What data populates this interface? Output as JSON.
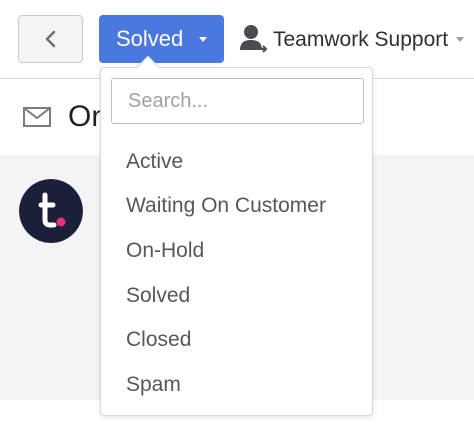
{
  "toolbar": {
    "back_icon": "chevron-left-icon",
    "status_button": {
      "label": "Solved",
      "color": "#4a78df"
    },
    "assignee": {
      "icon": "user-assign-icon",
      "name": "Teamwork Support"
    }
  },
  "ticket": {
    "subject_icon": "envelope-icon",
    "subject_partial": "On"
  },
  "status_dropdown": {
    "search_placeholder": "Search...",
    "options": [
      "Active",
      "Waiting On Customer",
      "On-Hold",
      "Solved",
      "Closed",
      "Spam"
    ]
  },
  "colors": {
    "accent": "#4a78df",
    "avatar_bg": "#1c1f3a",
    "avatar_dot": "#e8337a"
  }
}
